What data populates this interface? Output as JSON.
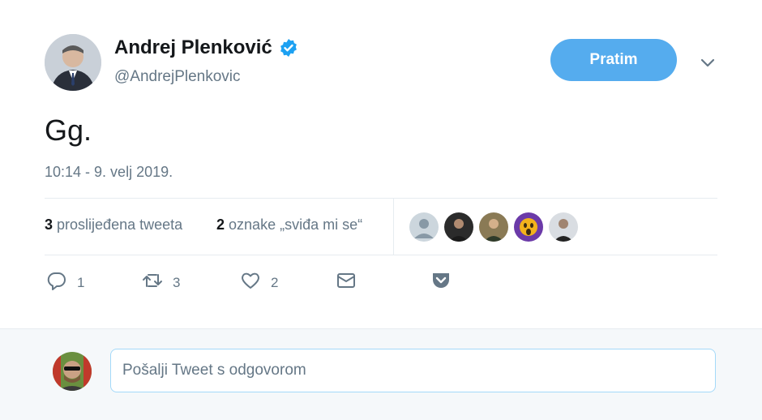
{
  "author": {
    "name": "Andrej Plenković",
    "handle": "@AndrejPlenkovic",
    "verified_icon": "verified-badge-icon"
  },
  "follow_button": {
    "label": "Pratim"
  },
  "tweet": {
    "text": "Gg.",
    "timestamp": "10:14 - 9. velj 2019."
  },
  "stats": {
    "retweets_count": "3",
    "retweets_label": "proslijeđena tweeta",
    "likes_count": "2",
    "likes_label": "oznake „sviđa mi se“"
  },
  "actions": {
    "reply_count": "1",
    "retweet_count": "3",
    "like_count": "2"
  },
  "reply": {
    "placeholder": "Pošalji Tweet s odgovorom"
  },
  "colors": {
    "accent": "#55acee",
    "muted": "#657786",
    "verified": "#1da1f2"
  }
}
